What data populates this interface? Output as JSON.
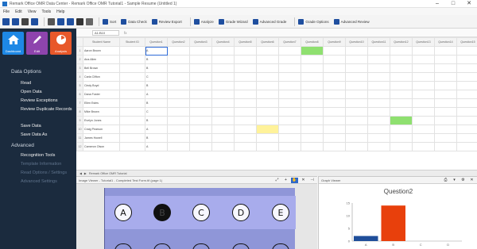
{
  "window": {
    "title": "Remark Office OMR Data Center - Remark Office OMR Tutorial1 - Sample Resume (Untitled 1)",
    "minimize": "–",
    "maximize": "□",
    "close": "✕"
  },
  "menu": [
    "File",
    "Edit",
    "View",
    "Tools",
    "Help"
  ],
  "toolbar": {
    "items": [
      "Sort",
      "Data Check",
      "Review Export",
      "Analyze",
      "Grade Wizard",
      "Advanced Grade",
      "Grade Options",
      "Advanced Review"
    ],
    "colors": {
      "blue": "#1f4f9f",
      "red": "#c8342b",
      "green": "#2e8b57"
    }
  },
  "sidebar": {
    "buttons": [
      {
        "label": "Dashboard",
        "color": "#1e88e5",
        "icon": "home-icon"
      },
      {
        "label": "Edit",
        "color": "#8e44ad",
        "icon": "pencil-icon"
      },
      {
        "label": "Analysis",
        "color": "#e8582a",
        "icon": "gauge-icon"
      }
    ],
    "section1": "Data Options",
    "items1": [
      "Read",
      "Open Data",
      "Review Exceptions",
      "Review Duplicate Records",
      "Save Data",
      "Save Data As"
    ],
    "section2": "Advanced",
    "items2": [
      "Recognition Tools",
      "Template Information",
      "Read Options / Settings",
      "Advanced Settings"
    ]
  },
  "grid": {
    "namebox": "A1:B10",
    "fx": "fx",
    "columns": [
      "",
      "Student Name",
      "Student ID",
      "Question1",
      "Question2",
      "Question3",
      "Question4",
      "Question5",
      "Question6",
      "Question7",
      "Question8",
      "Question9",
      "Question10",
      "Question11",
      "Question12",
      "Question13",
      "Question14",
      "Question15"
    ],
    "rows": [
      [
        "1",
        "Aaron Brown",
        "",
        "A",
        "",
        "",
        "",
        "",
        "",
        "",
        "",
        "",
        "",
        "",
        "",
        "",
        ""
      ],
      [
        "2",
        "Ana Allen",
        "",
        "B",
        "",
        "",
        "",
        "",
        "",
        "",
        "",
        "",
        "",
        "",
        "",
        "",
        ""
      ],
      [
        "3",
        "Bell Brown",
        "",
        "B",
        "",
        "",
        "",
        "",
        "",
        "",
        "",
        "",
        "",
        "",
        "",
        "",
        ""
      ],
      [
        "4",
        "Carla Clifton",
        "",
        "C",
        "",
        "",
        "",
        "",
        "",
        "",
        "",
        "",
        "",
        "",
        "",
        "",
        ""
      ],
      [
        "5",
        "Cindy Boyd",
        "",
        "B",
        "",
        "",
        "",
        "",
        "",
        "",
        "",
        "",
        "",
        "",
        "",
        "",
        ""
      ],
      [
        "6",
        "Dana Foster",
        "",
        "A",
        "",
        "",
        "",
        "",
        "",
        "",
        "",
        "",
        "",
        "",
        "",
        "",
        ""
      ],
      [
        "7",
        "Ellen Estes",
        "",
        "B",
        "",
        "",
        "",
        "",
        "",
        "",
        "",
        "",
        "",
        "",
        "",
        "",
        ""
      ],
      [
        "8",
        "Mike Brown",
        "",
        "C",
        "",
        "",
        "",
        "",
        "",
        "",
        "",
        "",
        "",
        "",
        "",
        "",
        ""
      ],
      [
        "9",
        "Evelyn Jones",
        "",
        "B",
        "",
        "",
        "",
        "",
        "",
        "",
        "",
        "",
        "",
        "",
        "",
        "",
        ""
      ],
      [
        "10",
        "Craig Pearson",
        "",
        "A",
        "",
        "",
        "",
        "",
        "",
        "",
        "",
        "",
        "",
        "",
        "",
        "",
        ""
      ],
      [
        "11",
        "James Howell",
        "",
        "B",
        "",
        "",
        "",
        "",
        "",
        "",
        "",
        "",
        "",
        "",
        "",
        "",
        ""
      ],
      [
        "12",
        "Cameron Olson",
        "",
        "A",
        "",
        "",
        "",
        "",
        "",
        "",
        "",
        "",
        "",
        "",
        "",
        "",
        ""
      ]
    ],
    "sheettab": "Remark Office OMR Tutorial"
  },
  "image_pane": {
    "title": "Image Viewer - Tutorial1 - Completed Test Form.tif (page 1)",
    "bubbles": [
      "A",
      "B",
      "C",
      "D",
      "E"
    ],
    "filled_index": 1
  },
  "graph_pane": {
    "title": "Graph Viewer"
  },
  "chart_data": {
    "type": "bar",
    "title": "Question2",
    "categories": [
      "A",
      "B",
      "C",
      "D"
    ],
    "series": [
      {
        "values": [
          2,
          0,
          0,
          0
        ],
        "color": "#1f4e9a"
      },
      {
        "values": [
          0,
          14,
          0,
          0
        ],
        "color": "#e8400c"
      },
      {
        "values": [
          0,
          0,
          0,
          0
        ],
        "color": "#777777"
      }
    ],
    "ylim": [
      0,
      15
    ],
    "yticks": [
      "0",
      "5",
      "10",
      "15"
    ]
  }
}
